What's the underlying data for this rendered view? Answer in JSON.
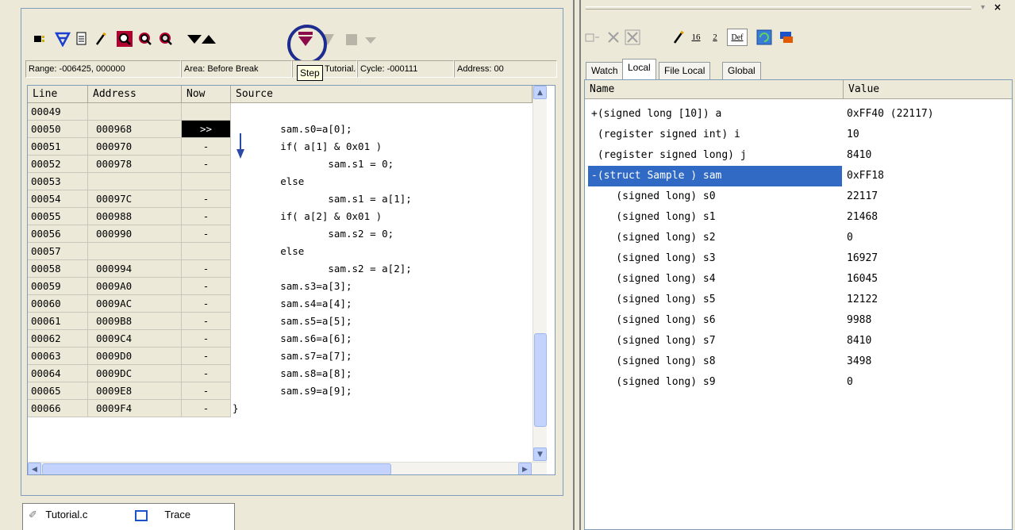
{
  "tooltip": "Step",
  "info_bar": {
    "range": "Range: -006425, 000000",
    "area": "Area: Before Break",
    "file": "Tutorial.c",
    "cycle": "Cycle: -000111",
    "address": "Address: 00"
  },
  "trace": {
    "headers": [
      "Line",
      "Address",
      "Now",
      "Source"
    ],
    "rows": [
      {
        "line": "00049",
        "address": "",
        "now": "",
        "source": ""
      },
      {
        "line": "00050",
        "address": "000968",
        "now": ">>",
        "source": "        sam.s0=a[0];"
      },
      {
        "line": "00051",
        "address": "000970",
        "now": "-",
        "source": "        if( a[1] & 0x01 )"
      },
      {
        "line": "00052",
        "address": "000978",
        "now": "-",
        "source": "                sam.s1 = 0;"
      },
      {
        "line": "00053",
        "address": "",
        "now": "",
        "source": "        else"
      },
      {
        "line": "00054",
        "address": "00097C",
        "now": "-",
        "source": "                sam.s1 = a[1];"
      },
      {
        "line": "00055",
        "address": "000988",
        "now": "-",
        "source": "        if( a[2] & 0x01 )"
      },
      {
        "line": "00056",
        "address": "000990",
        "now": "-",
        "source": "                sam.s2 = 0;"
      },
      {
        "line": "00057",
        "address": "",
        "now": "",
        "source": "        else"
      },
      {
        "line": "00058",
        "address": "000994",
        "now": "-",
        "source": "                sam.s2 = a[2];"
      },
      {
        "line": "00059",
        "address": "0009A0",
        "now": "-",
        "source": "        sam.s3=a[3];"
      },
      {
        "line": "00060",
        "address": "0009AC",
        "now": "-",
        "source": "        sam.s4=a[4];"
      },
      {
        "line": "00061",
        "address": "0009B8",
        "now": "-",
        "source": "        sam.s5=a[5];"
      },
      {
        "line": "00062",
        "address": "0009C4",
        "now": "-",
        "source": "        sam.s6=a[6];"
      },
      {
        "line": "00063",
        "address": "0009D0",
        "now": "-",
        "source": "        sam.s7=a[7];"
      },
      {
        "line": "00064",
        "address": "0009DC",
        "now": "-",
        "source": "        sam.s8=a[8];"
      },
      {
        "line": "00065",
        "address": "0009E8",
        "now": "-",
        "source": "        sam.s9=a[9];"
      },
      {
        "line": "00066",
        "address": "0009F4",
        "now": "-",
        "source": "}"
      }
    ]
  },
  "doc_tabs": [
    "Tutorial.c",
    "Trace"
  ],
  "watch": {
    "tabs": [
      "Watch",
      "Local",
      "File Local",
      "Global"
    ],
    "active_tab": "Local",
    "headers": [
      "Name",
      "Value"
    ],
    "rows": [
      {
        "name": "+(signed long [10]) a",
        "value": "0xFF40 (22117)"
      },
      {
        "name": " (register signed int) i",
        "value": "10"
      },
      {
        "name": " (register signed long) j",
        "value": "8410"
      },
      {
        "name": "-(struct Sample ) sam",
        "value": "0xFF18"
      },
      {
        "name": "    (signed long) s0",
        "value": "22117"
      },
      {
        "name": "    (signed long) s1",
        "value": "21468"
      },
      {
        "name": "    (signed long) s2",
        "value": "0"
      },
      {
        "name": "    (signed long) s3",
        "value": "16927"
      },
      {
        "name": "    (signed long) s4",
        "value": "16045"
      },
      {
        "name": "    (signed long) s5",
        "value": "12122"
      },
      {
        "name": "    (signed long) s6",
        "value": "9988"
      },
      {
        "name": "    (signed long) s7",
        "value": "8410"
      },
      {
        "name": "    (signed long) s8",
        "value": "3498"
      },
      {
        "name": "    (signed long) s9",
        "value": "0"
      }
    ]
  },
  "right_toolbar_labels": {
    "hex16": "16",
    "dec2": "2",
    "def": "Def"
  },
  "colors": {
    "accent": "#316ac5",
    "highlight_circle": "#1f2c8f",
    "step_arrow": "#2b4aa8"
  }
}
